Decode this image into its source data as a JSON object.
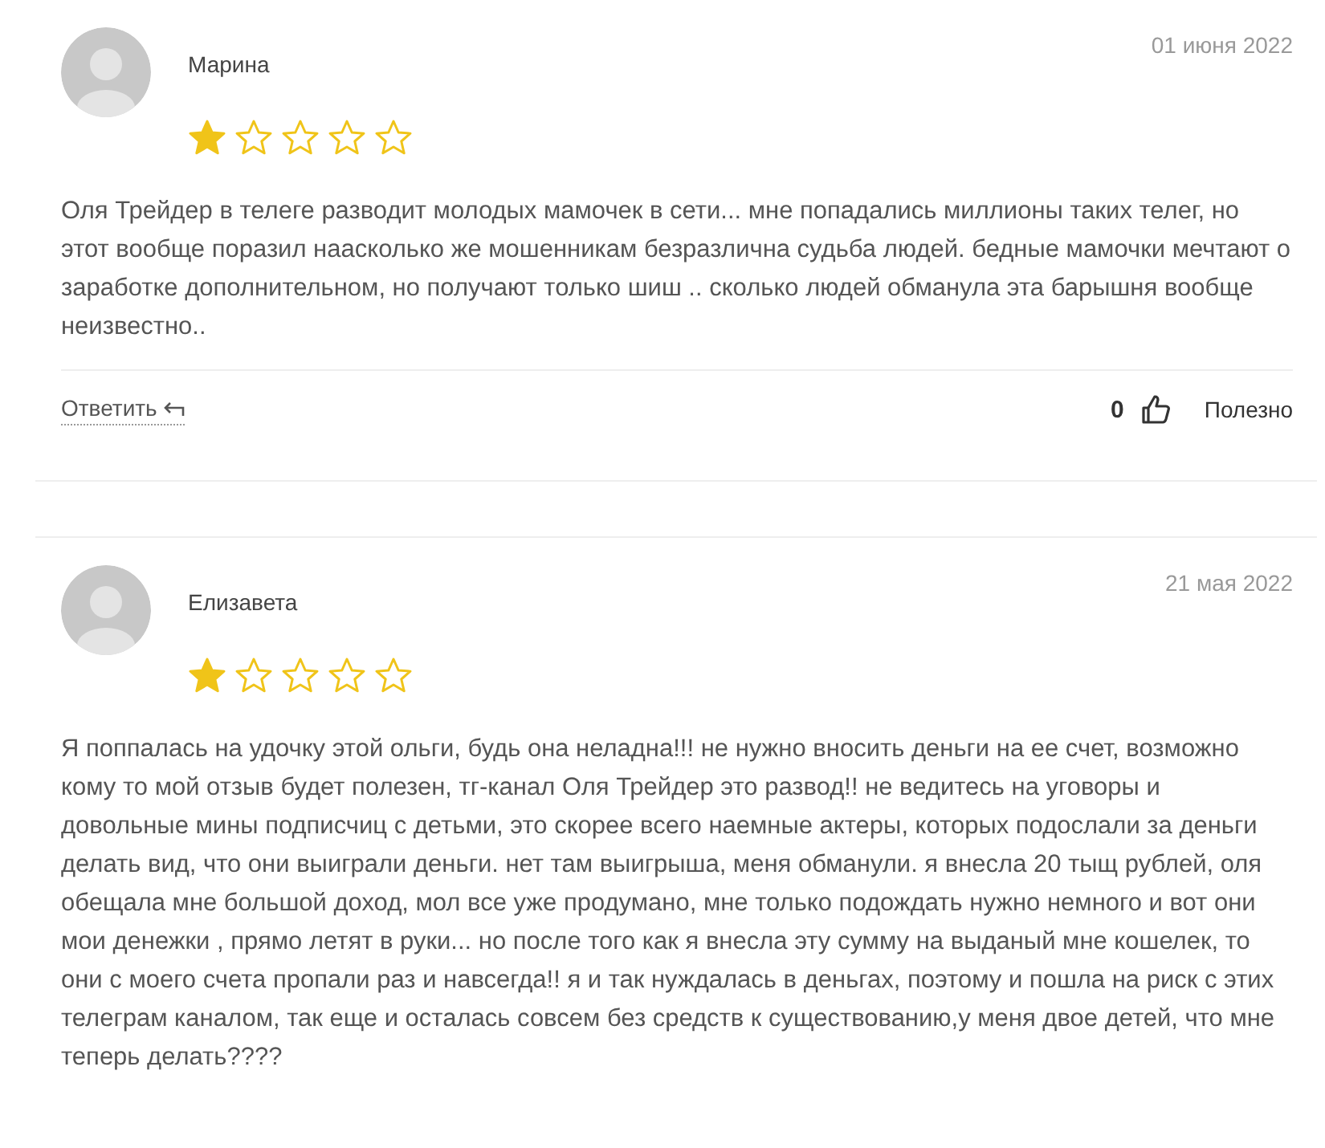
{
  "reviews": [
    {
      "author": "Марина",
      "date": "01 июня 2022",
      "stars": 1,
      "text": "Оля Трейдер в телеге разводит молодых мамочек в сети... мне попадались миллионы таких телег, но этот вообще поразил наасколько же мошенникам безразлична судьба людей. бедные мамочки мечтают о заработке дополнительном, но получают только шиш .. сколько людей обманула эта барышня вообще неизвестно..",
      "reply": "Ответить",
      "likes": "0",
      "helpful": "Полезно"
    },
    {
      "author": "Елизавета",
      "date": "21 мая 2022",
      "stars": 1,
      "text": "Я поппалась на удочку этой ольги, будь она неладна!!! не нужно вносить деньги на ее счет, возможно кому то мой отзыв будет полезен, тг-канал Оля Трейдер это развод!! не ведитесь на уговоры и довольные мины подписчиц с детьми, это скорее всего наемные актеры, которых подослали за деньги делать вид, что они выиграли деньги. нет там выигрыша, меня обманули. я внесла 20 тыщ рублей, оля обещала мне большой доход, мол все уже продумано, мне только подождать нужно немного и вот они мои денежки , прямо летят в руки... но после того как я внесла эту сумму на выданый мне кошелек, то они с моего счета пропали раз и навсегда!! я и так нуждалась в деньгах, поэтому и пошла на риск с этих телеграм каналом, так еще и осталась совсем без средств к существованию,у меня двое детей, что мне теперь делать????"
    }
  ]
}
